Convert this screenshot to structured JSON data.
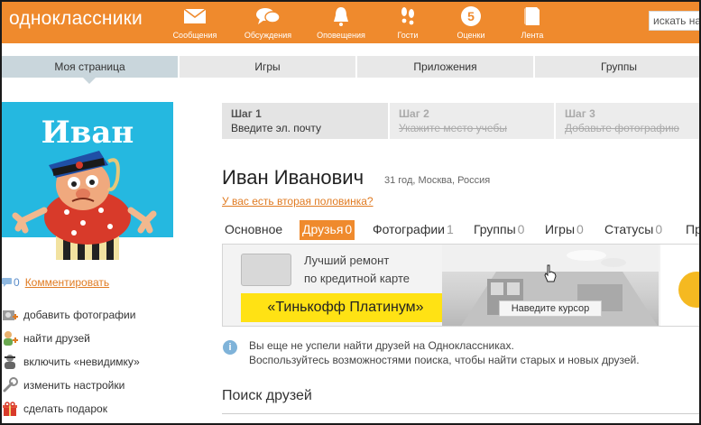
{
  "header": {
    "logo": "одноклассники",
    "nav": [
      {
        "label": "Сообщения",
        "icon": "envelope-icon"
      },
      {
        "label": "Обсуждения",
        "icon": "discussion-icon"
      },
      {
        "label": "Оповещения",
        "icon": "bell-icon"
      },
      {
        "label": "Гости",
        "icon": "footprints-icon"
      },
      {
        "label": "Оценки",
        "icon": "rating-badge-icon",
        "badge": "5"
      },
      {
        "label": "Лента",
        "icon": "feed-icon"
      }
    ],
    "search_placeholder": "искать на"
  },
  "tabs": [
    "Моя страница",
    "Игры",
    "Приложения",
    "Группы"
  ],
  "avatar": {
    "name": "Иван"
  },
  "comments": {
    "count": "0",
    "link": "Комментировать"
  },
  "left_menu": [
    {
      "label": "добавить фотографии",
      "icon": "add-photo-icon"
    },
    {
      "label": "найти друзей",
      "icon": "find-friends-icon"
    },
    {
      "label": "включить «невидимку»",
      "icon": "invisible-icon"
    },
    {
      "label": "изменить настройки",
      "icon": "settings-icon"
    },
    {
      "label": "сделать подарок",
      "icon": "gift-icon"
    }
  ],
  "steps": [
    {
      "title": "Шаг 1",
      "desc": "Введите эл. почту"
    },
    {
      "title": "Шаг 2",
      "desc": "Укажите место учебы"
    },
    {
      "title": "Шаг 3",
      "desc": "Добавьте фотографию"
    }
  ],
  "profile": {
    "name": "Иван Иванович",
    "meta": "31 год, Москва, Россия",
    "relationship_link": "У вас есть вторая половинка?"
  },
  "profile_tabs": [
    {
      "label": "Основное",
      "count": ""
    },
    {
      "label": "Друзья",
      "count": "0"
    },
    {
      "label": "Фотографии",
      "count": "1"
    },
    {
      "label": "Группы",
      "count": "0"
    },
    {
      "label": "Игры",
      "count": "0"
    },
    {
      "label": "Статусы",
      "count": "0"
    },
    {
      "label": "Пр",
      "count": ""
    }
  ],
  "banner": {
    "line1": "Лучший ремонт",
    "line2": "по кредитной карте",
    "button": "«Тинькофф Платинум»",
    "hint": "Наведите курсор"
  },
  "notice": {
    "line1": "Вы еще не успели найти друзей на Одноклассниках.",
    "line2": "Воспользуйтесь возможностями поиска, чтобы найти старых и новых друзей."
  },
  "search_friends": {
    "title": "Поиск друзей"
  },
  "colors": {
    "brand": "#ef8a2d",
    "link": "#e07b22",
    "banner_button": "#ffe214"
  }
}
